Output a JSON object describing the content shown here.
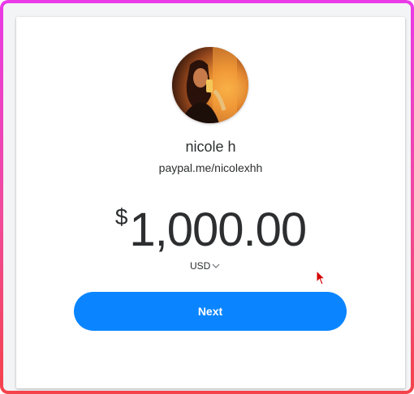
{
  "profile": {
    "avatar_icon": "profile-photo",
    "name": "nicole h",
    "paypal_link": "paypal.me/nicolexhh"
  },
  "payment": {
    "currency_symbol": "$",
    "amount": "1,000.00",
    "currency_code": "USD",
    "currency_dropdown_icon": "chevron-down-icon"
  },
  "actions": {
    "next_label": "Next"
  },
  "colors": {
    "primary_button": "#0a85ff",
    "text": "#2c2e2f",
    "frame_gradient_top": "#e93ae8",
    "frame_gradient_bottom": "#f4434a"
  }
}
